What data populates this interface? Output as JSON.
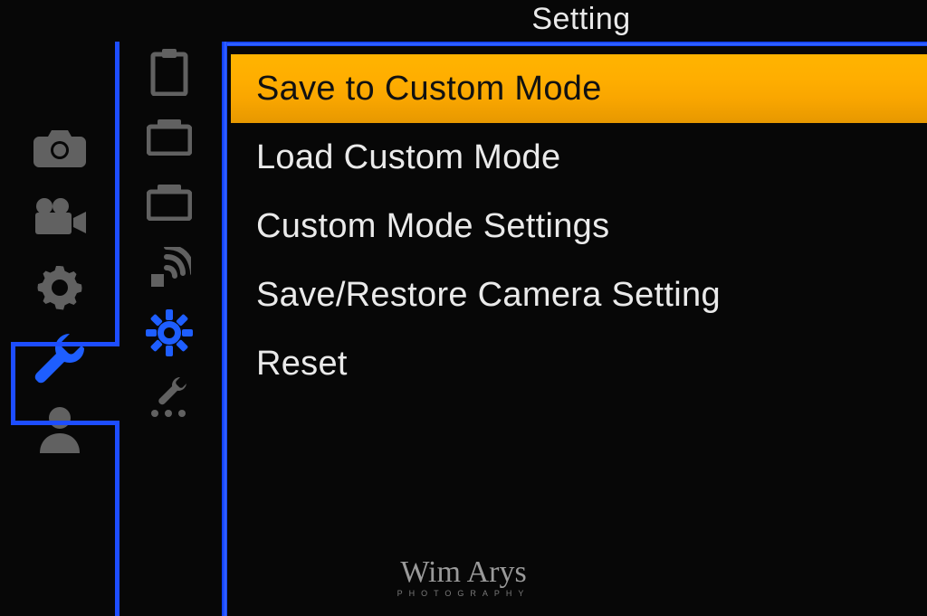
{
  "header": {
    "title": "Setting"
  },
  "primary_tabs": [
    {
      "name": "camera",
      "selected": false
    },
    {
      "name": "video",
      "selected": false
    },
    {
      "name": "gear",
      "selected": false
    },
    {
      "name": "wrench",
      "selected": true
    },
    {
      "name": "profile",
      "selected": false
    }
  ],
  "secondary_tabs": [
    {
      "name": "clipboard",
      "selected": false
    },
    {
      "name": "folder1",
      "selected": false
    },
    {
      "name": "folder2",
      "selected": false
    },
    {
      "name": "wireless",
      "selected": false
    },
    {
      "name": "cog",
      "selected": true
    },
    {
      "name": "wrench-sub",
      "selected": false
    }
  ],
  "menu": {
    "items": [
      {
        "label": "Save to Custom Mode",
        "selected": true
      },
      {
        "label": "Load Custom Mode",
        "selected": false
      },
      {
        "label": "Custom Mode Settings",
        "selected": false
      },
      {
        "label": "Save/Restore Camera Setting",
        "selected": false
      },
      {
        "label": "Reset",
        "selected": false
      }
    ]
  },
  "watermark": {
    "main": "Wim Arys",
    "sub": "PHOTOGRAPHY"
  },
  "colors": {
    "accent": "#1e5eff",
    "highlight": "#ffae00"
  }
}
